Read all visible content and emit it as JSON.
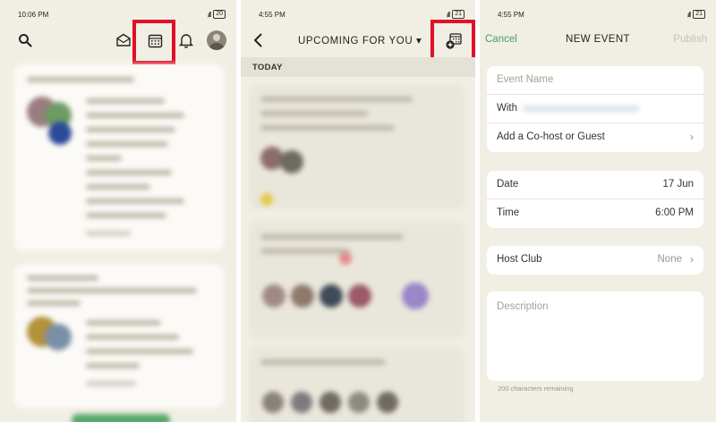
{
  "panel1": {
    "status_time": "10:06 PM",
    "battery": "20",
    "icons": [
      "search-icon",
      "envelope-icon",
      "calendar-icon",
      "bell-icon",
      "avatar"
    ]
  },
  "panel2": {
    "status_time": "4:55 PM",
    "battery": "21",
    "title": "UPCOMING FOR YOU ▾",
    "section": "TODAY",
    "icons": [
      "back-icon",
      "add-event-icon"
    ]
  },
  "panel3": {
    "status_time": "4:55 PM",
    "battery": "21",
    "cancel": "Cancel",
    "title": "NEW EVENT",
    "publish": "Publish",
    "event_name_placeholder": "Event Name",
    "with_label": "With",
    "cohost_label": "Add a Co-host or Guest",
    "date_label": "Date",
    "date_value": "17 Jun",
    "time_label": "Time",
    "time_value": "6:00 PM",
    "host_club_label": "Host Club",
    "host_club_value": "None",
    "description_placeholder": "Description",
    "chars_remaining": "200 characters remaining"
  },
  "colors": {
    "highlight": "#e0102a",
    "accent": "#4b9b63",
    "background": "#f1efe4"
  }
}
